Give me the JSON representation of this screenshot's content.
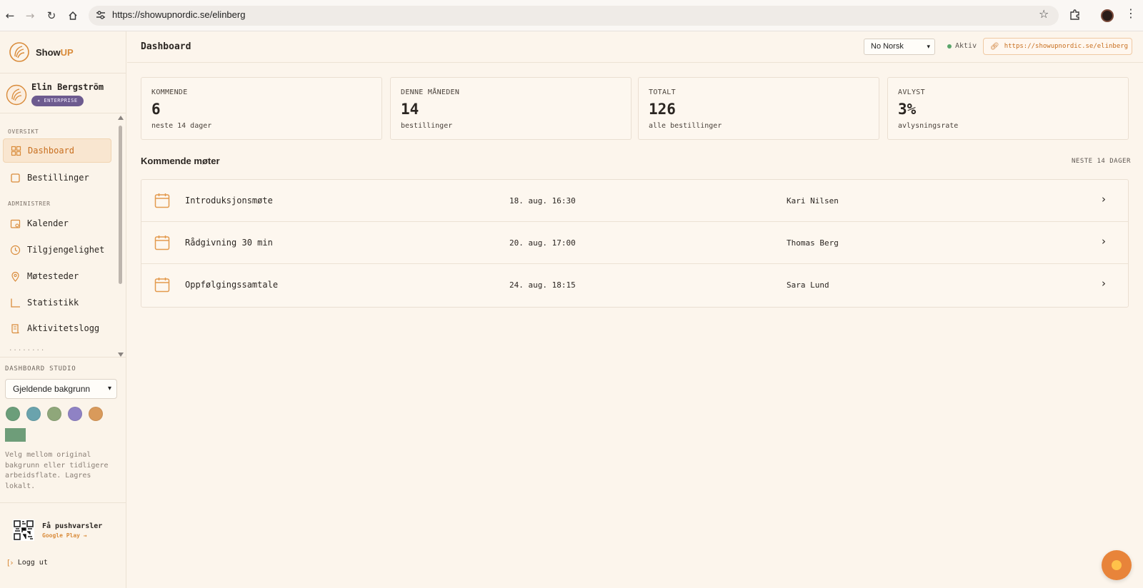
{
  "browser": {
    "url": "https://showupnordic.se/elinberg",
    "icons": [
      "back-arrow-icon",
      "forward-arrow-icon",
      "reload-icon",
      "home-icon",
      "site-settings-icon",
      "bookmark-star-icon",
      "extensions-icon",
      "profile-icon",
      "menu-icon"
    ]
  },
  "brand": {
    "name_part1": "Show",
    "name_part2": "UP",
    "accent_color": "#d98b3a"
  },
  "user": {
    "name": "Elin Bergström",
    "badge": "✦ ENTERPRISE",
    "badge_color": "#6d5b8f"
  },
  "sidebar": {
    "section_overview": "OVERSIKT",
    "section_admin": "ADMINISTRER",
    "items": [
      {
        "label": "Dashboard",
        "icon": "grid-icon",
        "active": true
      },
      {
        "label": "Bestillinger",
        "icon": "square-icon"
      },
      {
        "label": "Kalender",
        "icon": "calendar-icon"
      },
      {
        "label": "Tilgjengelighet",
        "icon": "clock-icon"
      },
      {
        "label": "Møtesteder",
        "icon": "location-pin-icon"
      },
      {
        "label": "Statistikk",
        "icon": "chart-icon"
      },
      {
        "label": "Aktivitetslogg",
        "icon": "scroll-log-icon"
      }
    ],
    "more": "........"
  },
  "studio": {
    "label": "DASHBOARD STUDIO",
    "select_value": "Gjeldende bakgrunn",
    "swatches": [
      "#6b9e7a",
      "#6aa3ad",
      "#8fa77a",
      "#8f82c4",
      "#d99a5b"
    ],
    "rect_swatch": "#6e9d79",
    "help": "Velg mellom original bakgrunn eller tidligere arbeidsflate. Lagres lokalt."
  },
  "push": {
    "title": "Få pushvarsler",
    "sub": "Google Play →"
  },
  "logout": "Logg ut",
  "header": {
    "title": "Dashboard",
    "language": "No Norsk",
    "status": "Aktiv",
    "status_color": "#5aa56a",
    "link": "https://showupnordic.se/elinberg"
  },
  "stats": [
    {
      "label": "KOMMENDE",
      "value": "6",
      "sub": "neste 14 dager"
    },
    {
      "label": "DENNE MÅNEDEN",
      "value": "14",
      "sub": "bestillinger"
    },
    {
      "label": "TOTALT",
      "value": "126",
      "sub": "alle bestillinger"
    },
    {
      "label": "AVLYST",
      "value": "3%",
      "sub": "avlysningsrate"
    }
  ],
  "upcoming": {
    "title": "Kommende møter",
    "meta": "NESTE 14 DAGER",
    "rows": [
      {
        "title": "Introduksjonsmøte",
        "time": "18. aug. 16:30",
        "person": "Kari Nilsen"
      },
      {
        "title": "Rådgivning 30 min",
        "time": "20. aug. 17:00",
        "person": "Thomas Berg"
      },
      {
        "title": "Oppfølgingssamtale",
        "time": "24. aug. 18:15",
        "person": "Sara Lund"
      }
    ]
  }
}
